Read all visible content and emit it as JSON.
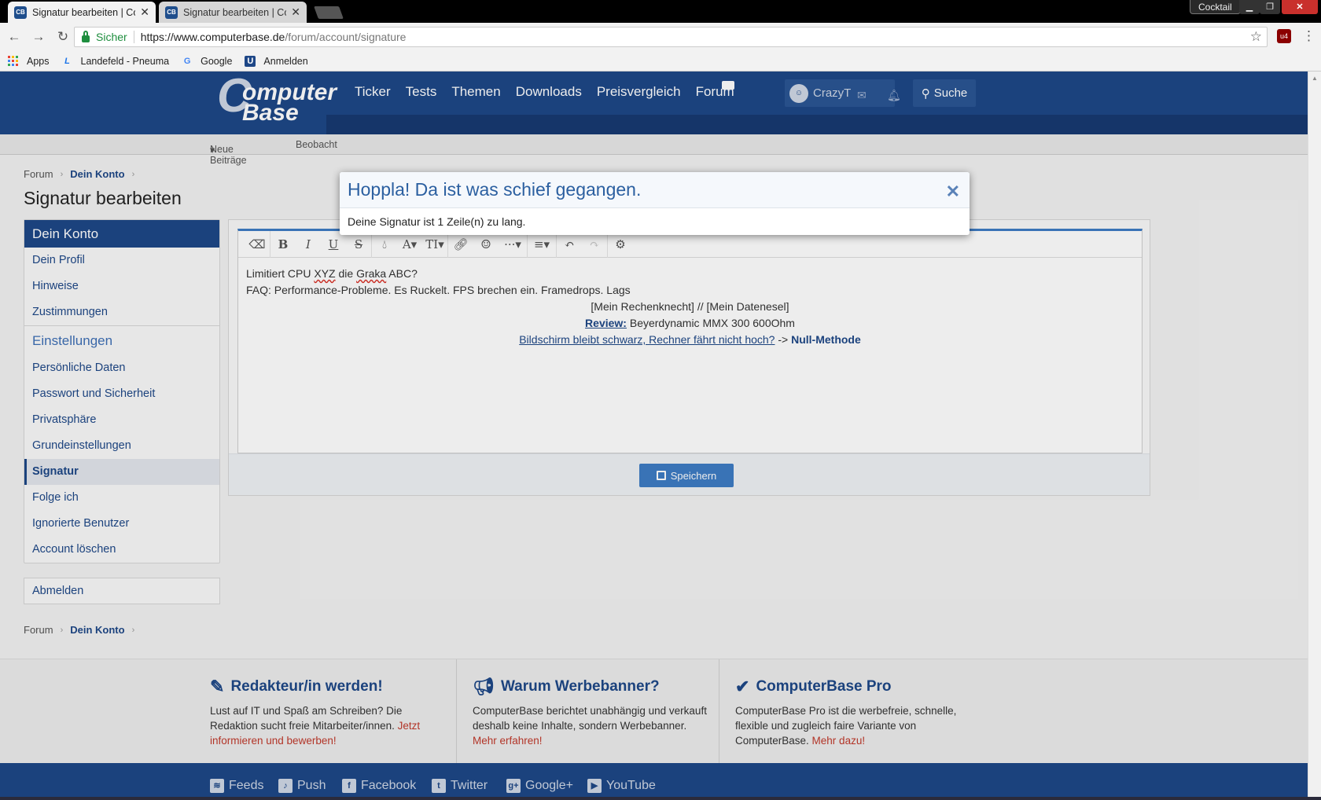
{
  "browser": {
    "tabs": [
      {
        "title": "Signatur bearbeiten | Cor",
        "active": true
      },
      {
        "title": "Signatur bearbeiten | Cor",
        "active": false
      }
    ],
    "profile": "Cocktail",
    "window_controls": [
      "minimize",
      "restore",
      "close"
    ],
    "secure_label": "Sicher",
    "url_host": "https://www.computerbase.de",
    "url_path": "/forum/account/signature",
    "extension_badge": "4",
    "bookmarks": [
      {
        "label": "Apps",
        "icon": "apps-grid-icon"
      },
      {
        "label": "Landefeld - Pneuma",
        "icon": "landefeld-icon"
      },
      {
        "label": "Google",
        "icon": "google-icon"
      },
      {
        "label": "Anmelden",
        "icon": "anmelden-icon"
      }
    ]
  },
  "site": {
    "logo_line1": "omputer",
    "logo_line2": "Base",
    "nav": [
      "Ticker",
      "Tests",
      "Themen",
      "Downloads",
      "Preisvergleich",
      "Forum"
    ],
    "username": "CrazyT",
    "search_label": "Suche",
    "subnav": [
      "Neue Beiträge",
      "Beobacht"
    ]
  },
  "breadcrumb": {
    "root": "Forum",
    "current": "Dein Konto"
  },
  "page_title": "Signatur bearbeiten",
  "sidebar": {
    "header": "Dein Konto",
    "items1": [
      "Dein Profil",
      "Hinweise",
      "Zustimmungen"
    ],
    "group": "Einstellungen",
    "items2": [
      "Persönliche Daten",
      "Passwort und Sicherheit",
      "Privatsphäre",
      "Grundeinstellungen",
      "Signatur",
      "Folge ich",
      "Ignorierte Benutzer",
      "Account löschen"
    ],
    "active": "Signatur",
    "logout": "Abmelden"
  },
  "editor": {
    "line1_a": "Limitiert CPU ",
    "line1_b": "XYZ",
    "line1_c": " die ",
    "line1_d": "Graka",
    "line1_e": " ABC?",
    "line2": "FAQ: Performance-Probleme. Es Ruckelt. FPS brechen ein. Framedrops. Lags",
    "line3": "[Mein Rechenknecht] // [Mein Datenesel]",
    "line4_label": "Review:",
    "line4_text": " Beyerdynamic MMX 300 600Ohm",
    "line5_link": "Bildschirm bleibt schwarz, Rechner fährt nicht hoch?",
    "line5_arrow": " -> ",
    "line5_bold": "Null-Methode",
    "save_label": "Speichern"
  },
  "modal": {
    "title": "Hoppla! Da ist was schief gegangen.",
    "message": "Deine Signatur ist 1 Zeile(n) zu lang."
  },
  "promos": [
    {
      "title": "Redakteur/in werden!",
      "text": "Lust auf IT und Spaß am Schreiben? Die Redaktion sucht freie Mitarbeiter/innen. ",
      "link": "Jetzt informieren und bewerben!"
    },
    {
      "title": "Warum Werbebanner?",
      "text": "ComputerBase berichtet unabhängig und verkauft deshalb keine Inhalte, sondern Werbebanner. ",
      "link": "Mehr erfahren!"
    },
    {
      "title": "ComputerBase Pro",
      "text": "ComputerBase Pro ist die werbefreie, schnelle, flexible und zugleich faire Variante von ComputerBase. ",
      "link": "Mehr dazu!"
    }
  ],
  "social": [
    "Feeds",
    "Push",
    "Facebook",
    "Twitter",
    "Google+",
    "YouTube"
  ],
  "colors": {
    "brand": "#1e4787",
    "accent": "#3e7cc4",
    "link_red": "#c0392b"
  }
}
